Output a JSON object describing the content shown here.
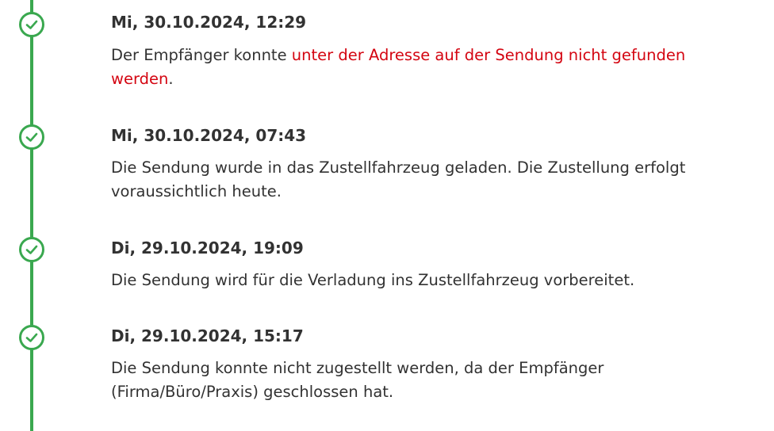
{
  "colors": {
    "timeline": "#3aa84f",
    "text": "#323232",
    "highlight": "#d40511"
  },
  "events": [
    {
      "date": "Mi, 30.10.2024, 12:29",
      "text_before": "Der Empfänger konnte ",
      "text_highlight": "unter der Adresse auf der Sendung nicht gefunden werden",
      "text_after": ".",
      "icon": "check-circle-icon"
    },
    {
      "date": "Mi, 30.10.2024, 07:43",
      "text": "Die Sendung wurde in das Zustellfahrzeug geladen. Die Zustellung erfolgt voraussichtlich heute.",
      "icon": "check-circle-icon"
    },
    {
      "date": "Di, 29.10.2024, 19:09",
      "text": "Die Sendung wird für die Verladung ins Zustellfahrzeug vorbereitet.",
      "icon": "check-circle-icon"
    },
    {
      "date": "Di, 29.10.2024, 15:17",
      "text": "Die Sendung konnte nicht zugestellt werden, da der Empfänger (Firma/Büro/Praxis) geschlossen hat.",
      "icon": "check-circle-icon"
    }
  ]
}
